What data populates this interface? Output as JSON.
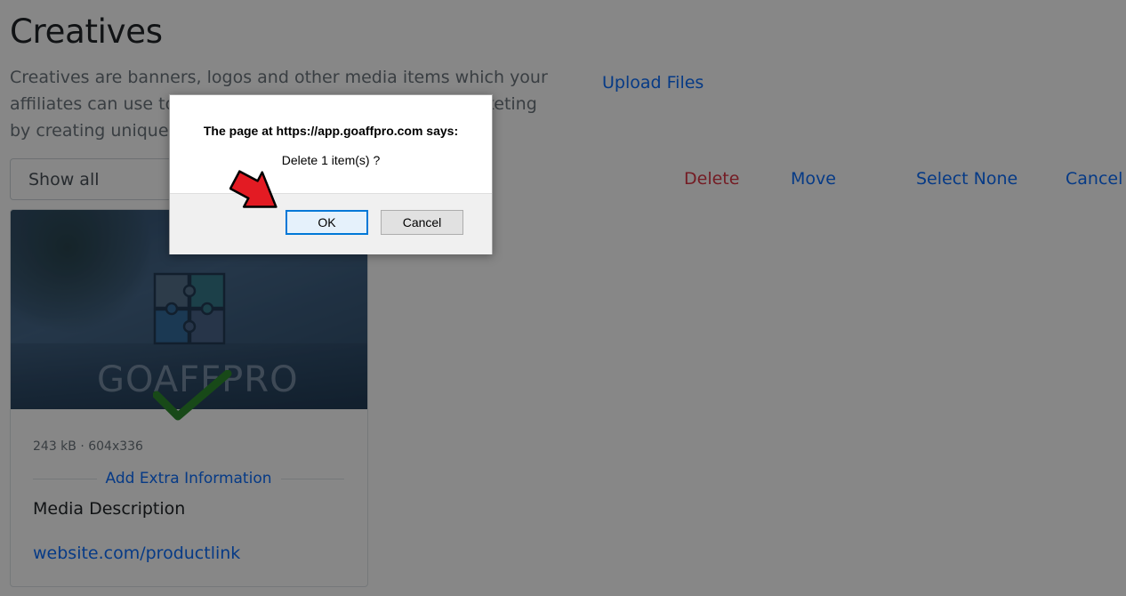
{
  "page": {
    "title": "Creatives",
    "description": "Creatives are banners, logos and other media items which your affiliates can use to promote your store. Boost your marketing by creating unique, catchy images",
    "upload_label": "Upload Files"
  },
  "toolbar": {
    "filter_value": "Show all",
    "delete_label": "Delete",
    "move_label": "Move",
    "select_none_label": "Select None",
    "cancel_label": "Cancel"
  },
  "card": {
    "logo_text": "GOAFFPRO",
    "meta": "243 kB · 604x336",
    "extra_label": "Add Extra Information",
    "description": "Media Description",
    "link": "website.com/productlink",
    "selected": true
  },
  "dialog": {
    "title": "The page at https://app.goaffpro.com says:",
    "message": "Delete 1 item(s) ?",
    "ok_label": "OK",
    "cancel_label": "Cancel"
  },
  "colors": {
    "link": "#0d6efd",
    "danger": "#dc3545",
    "check": "#2e8b2e",
    "arrow": "#e31b23"
  },
  "icons": {
    "checkmark": "checkmark-icon",
    "annotation": "red-arrow-icon",
    "logo": "puzzle-logo-icon"
  }
}
